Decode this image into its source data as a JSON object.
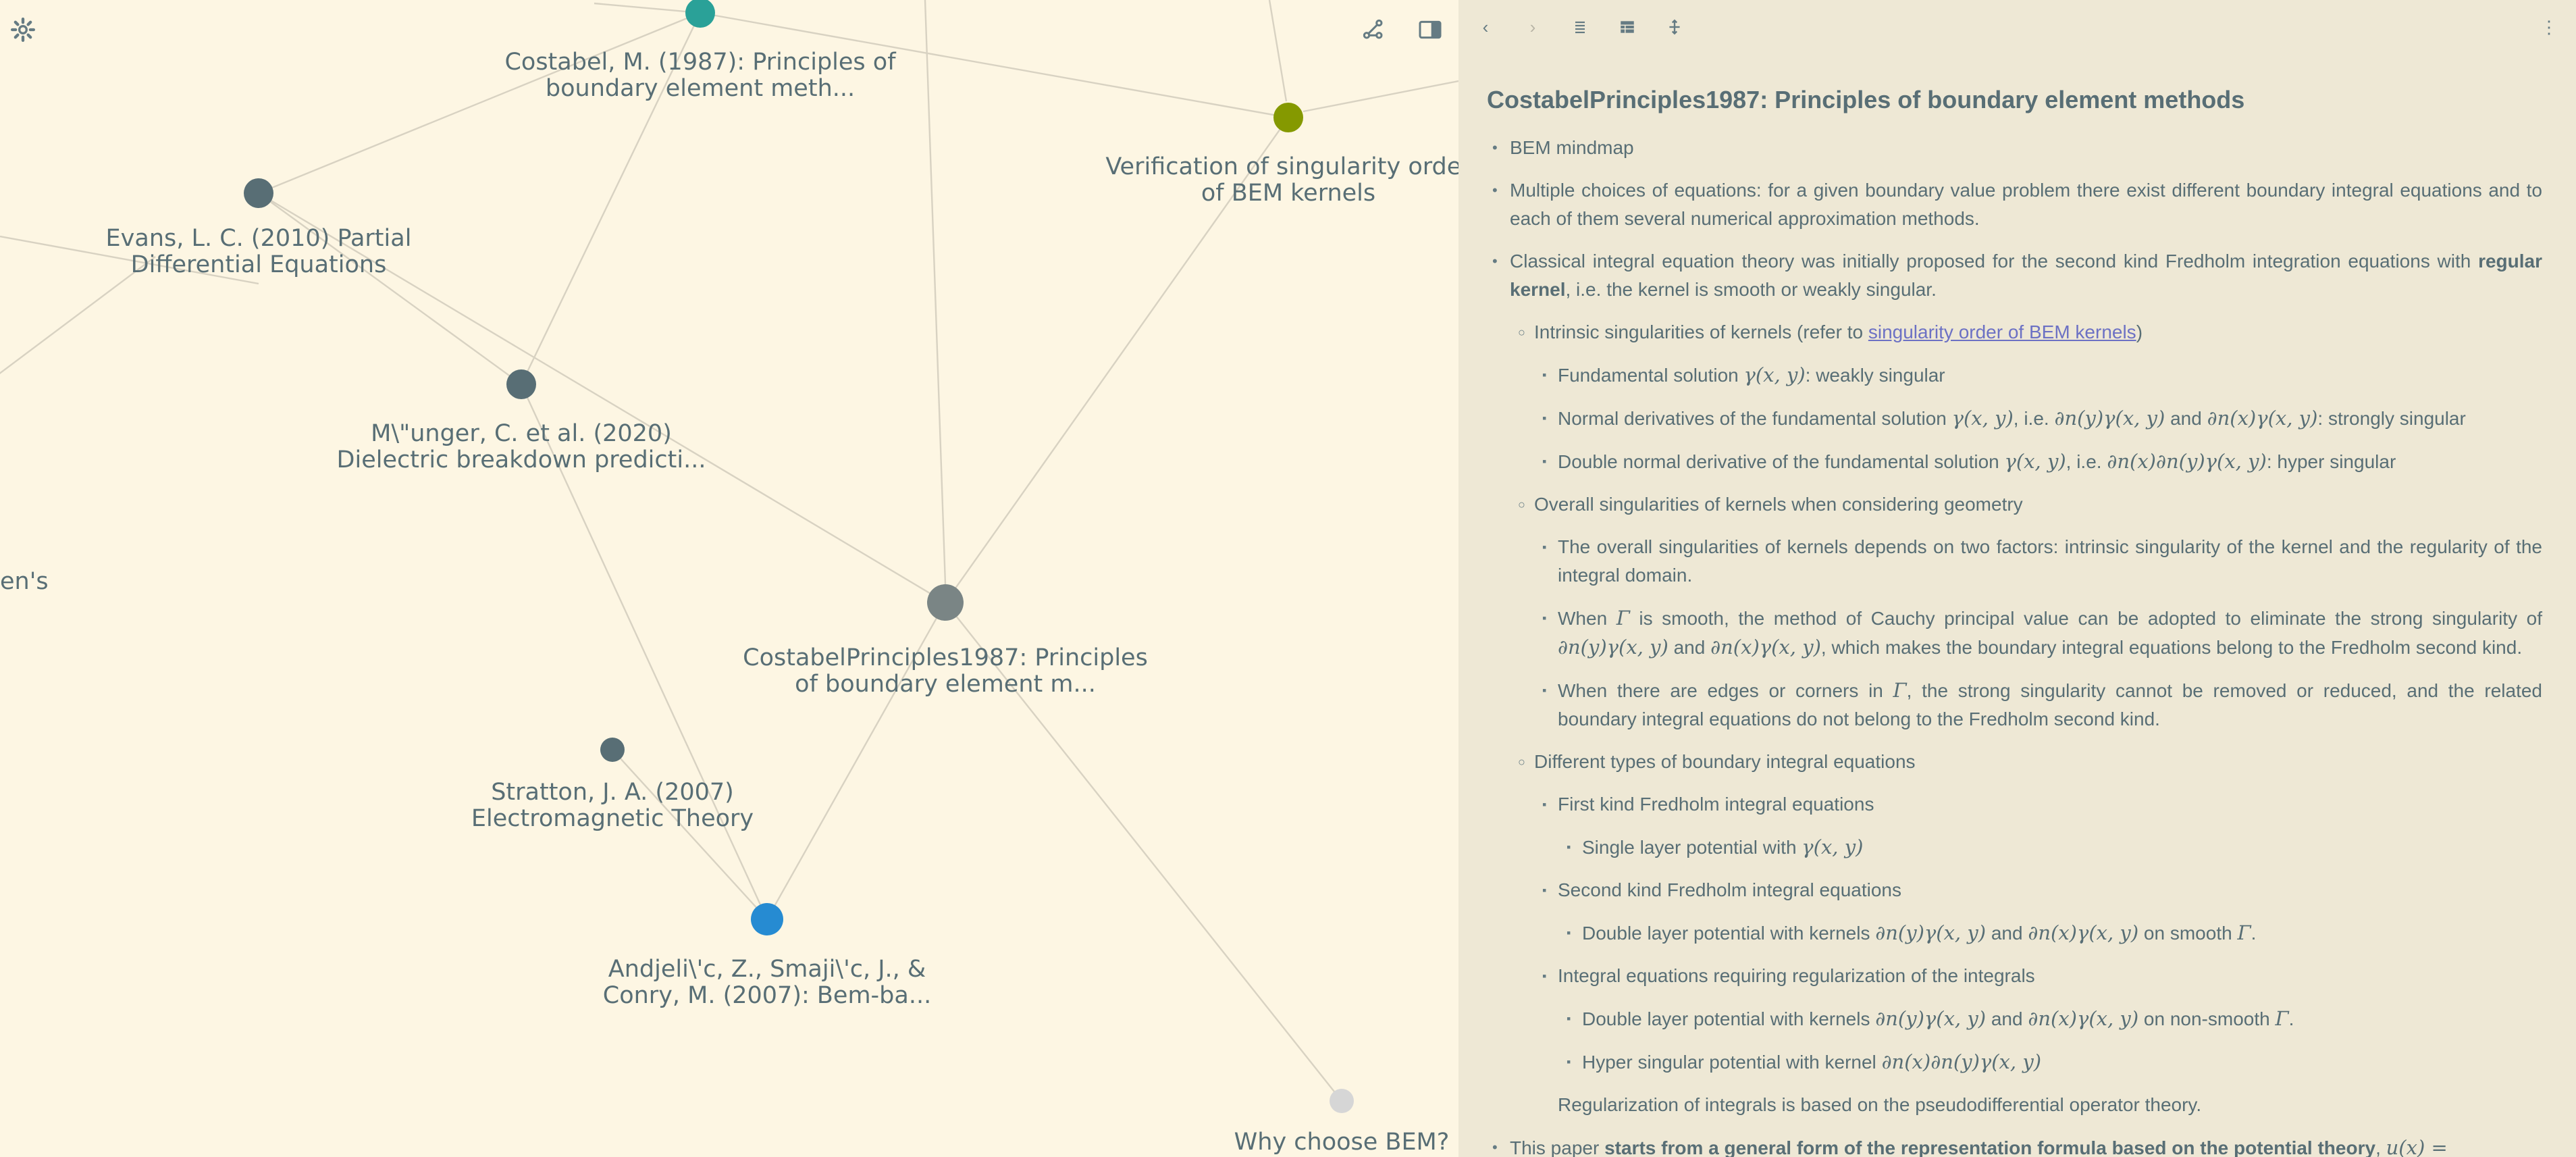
{
  "graph": {
    "edge_color": "#d8d2c2",
    "nodes": [
      {
        "id": "costabel1987",
        "label_lines": [
          "Costabel, M. (1987): Principles of",
          "boundary element meth..."
        ],
        "color": "#2aa198"
      },
      {
        "id": "verification",
        "label_lines": [
          "Verification of singularity order",
          "of BEM kernels"
        ],
        "color": "#859900"
      },
      {
        "id": "evans",
        "label_lines": [
          "Evans, L. C. (2010) Partial",
          "Differential Equations"
        ],
        "color": "#586e75"
      },
      {
        "id": "munger",
        "label_lines": [
          "M\\\"unger, C. et al. (2020)",
          "Dielectric breakdown predicti..."
        ],
        "color": "#586e75"
      },
      {
        "id": "principles",
        "label_lines": [
          "CostabelPrinciples1987: Principles",
          "of boundary element m..."
        ],
        "color": "#7a8585"
      },
      {
        "id": "stratton",
        "label_lines": [
          "Stratton, J. A. (2007)",
          "Electromagnetic Theory"
        ],
        "color": "#586e75"
      },
      {
        "id": "andjelic",
        "label_lines": [
          "Andjeli\\'c, Z., Smaji\\'c, J., &",
          "Conry, M. (2007): Bem-ba..."
        ],
        "color": "#268bd2"
      },
      {
        "id": "whybem",
        "label_lines": [
          "Why choose BEM?"
        ],
        "color": "#d6d6d6"
      },
      {
        "id": "greens",
        "label_lines": [
          "en's"
        ],
        "color": "#586e75"
      }
    ],
    "edges": [
      [
        "costabel1987",
        "verification"
      ],
      [
        "costabel1987",
        "evans"
      ],
      [
        "costabel1987",
        "munger"
      ],
      [
        "verification",
        "principles"
      ],
      [
        "evans",
        "principles"
      ],
      [
        "evans",
        "munger"
      ],
      [
        "munger",
        "andjelic"
      ],
      [
        "principles",
        "andjelic"
      ],
      [
        "stratton",
        "andjelic"
      ],
      [
        "principles",
        "whybem"
      ]
    ]
  },
  "panel": {
    "title": "CostabelPrinciples1987: Principles of boundary element methods",
    "toolbar": {
      "back": "back-icon",
      "forward": "forward-icon",
      "view_text": "text-view-icon",
      "view_table": "table-view-icon",
      "move": "move-icon",
      "more": "more-icon"
    },
    "items": {
      "bem_mindmap": "BEM mindmap",
      "multiple_choices": "Multiple choices of equations: for a given boundary value problem there exist different boundary integral equations and to each of them several numerical approximation methods.",
      "classical_pre": "Classical integral equation theory was initially proposed for the second kind Fredholm integration equations with ",
      "classical_bold": "regular kernel",
      "classical_post": ", i.e. the kernel is smooth or weakly singular.",
      "intrinsic_pre": "Intrinsic singularities of kernels (refer to ",
      "intrinsic_link": "singularity order of BEM kernels",
      "intrinsic_post": ")",
      "fundamental_pre": "Fundamental solution ",
      "fundamental_math": "γ(x, y)",
      "fundamental_post": ": weakly singular",
      "normal_pre": "Normal derivatives of the fundamental solution ",
      "normal_math1": "γ(x, y)",
      "normal_mid1": ", i.e. ",
      "normal_math2": "∂n(y)γ(x, y)",
      "normal_mid2": " and ",
      "normal_math3": "∂n(x)γ(x, y)",
      "normal_post": ": strongly singular",
      "double_pre": "Double normal derivative of the fundamental solution ",
      "double_math1": "γ(x, y)",
      "double_mid": ", i.e. ",
      "double_math2": "∂n(x)∂n(y)γ(x, y)",
      "double_post": ": hyper singular",
      "overall": "Overall singularities of kernels when considering geometry",
      "overall_factors": "The overall singularities of kernels depends on two factors: intrinsic singularity of the kernel and the regularity of the integral domain.",
      "smooth_pre": "When ",
      "smooth_math1": "Γ",
      "smooth_mid1": " is smooth, the method of Cauchy principal value can be adopted to eliminate the strong singularity of ",
      "smooth_math2": "∂n(y)γ(x, y)",
      "smooth_mid2": " and ",
      "smooth_math3": "∂n(x)γ(x, y)",
      "smooth_post": ", which makes the boundary integral equations belong to the Fredholm second kind.",
      "edges_pre": "When there are edges or corners in ",
      "edges_math": "Γ",
      "edges_post": ", the strong singularity cannot be removed or reduced, and the related boundary integral equations do not belong to the Fredholm second kind.",
      "different_types": "Different types of boundary integral equations",
      "first_kind": "First kind Fredholm integral equations",
      "single_layer_pre": "Single layer potential with ",
      "single_layer_math": "γ(x, y)",
      "second_kind": "Second kind Fredholm integral equations",
      "dl_smooth_pre": "Double layer potential with kernels ",
      "dl_smooth_math1": "∂n(y)γ(x, y)",
      "dl_smooth_mid": " and ",
      "dl_smooth_math2": "∂n(x)γ(x, y)",
      "dl_smooth_mid2": " on smooth ",
      "dl_smooth_math3": "Γ",
      "dl_smooth_post": ".",
      "regularization": "Integral equations requiring regularization of the integrals",
      "dl_nonsmooth_pre": "Double layer potential with kernels ",
      "dl_nonsmooth_math1": "∂n(y)γ(x, y)",
      "dl_nonsmooth_mid": " and ",
      "dl_nonsmooth_math2": "∂n(x)γ(x, y)",
      "dl_nonsmooth_mid2": " on non-smooth ",
      "dl_nonsmooth_math3": "Γ",
      "dl_nonsmooth_post": ".",
      "hyper_pre": "Hyper singular potential with kernel ",
      "hyper_math": "∂n(x)∂n(y)γ(x, y)",
      "regularization_note": "Regularization of integrals is based on the pseudodifferential operator theory.",
      "paper_pre": "This paper ",
      "paper_bold": "starts from a general form of the representation formula based on the potential theory",
      "paper_post": ", ",
      "paper_math": "u(x) ="
    }
  }
}
